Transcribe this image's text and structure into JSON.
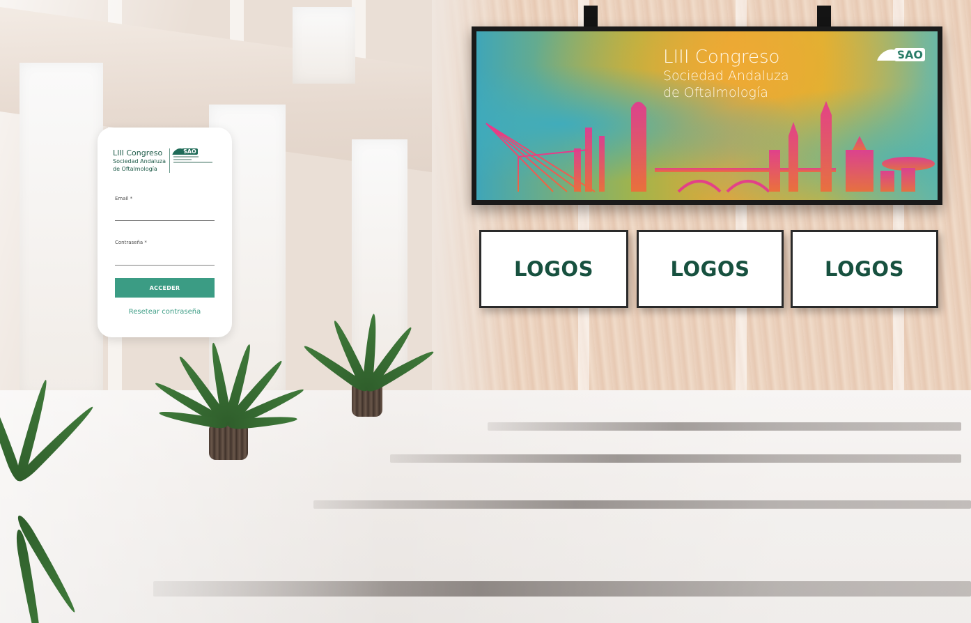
{
  "banner": {
    "title_line1": "LIII Congreso",
    "title_line2": "Sociedad Andaluza",
    "title_line3": "de Oftalmología",
    "logo_text": "SAO"
  },
  "logo_panels": [
    {
      "label": "LOGOS"
    },
    {
      "label": "LOGOS"
    },
    {
      "label": "LOGOS"
    }
  ],
  "login": {
    "title_line1": "LIII Congreso",
    "title_line2": "Sociedad Andaluza",
    "title_line3": "de Oftalmología",
    "brand_logo": "SAO",
    "email_label": "Email *",
    "email_value": "",
    "password_label": "Contraseña *",
    "password_value": "",
    "submit_label": "ACCEDER",
    "reset_label": "Resetear contraseña"
  },
  "colors": {
    "accent": "#3b9c84",
    "logo_text": "#17513f",
    "brand_dark": "#205c4a"
  }
}
